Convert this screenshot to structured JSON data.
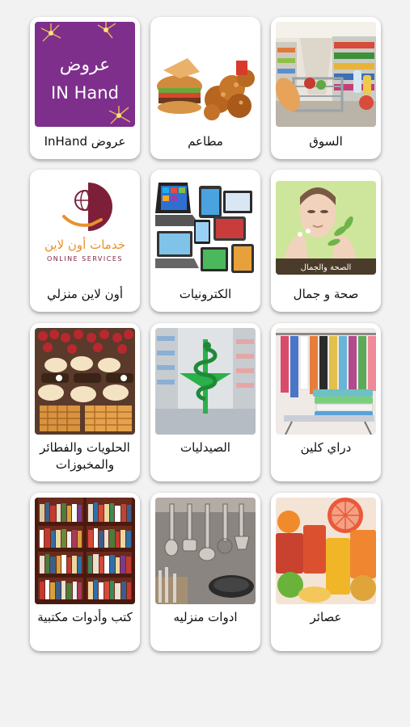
{
  "categories": [
    {
      "label": "السوق",
      "icon": "supermarket-image"
    },
    {
      "label": "مطاعم",
      "icon": "fastfood-image"
    },
    {
      "label": "عروض InHand",
      "icon": "offers-inhand-image",
      "image_text": "عروض IN Hand"
    },
    {
      "label": "صحة و جمال",
      "icon": "health-beauty-image",
      "image_text": "الصحة والجمال"
    },
    {
      "label": "الكترونيات",
      "icon": "electronics-image"
    },
    {
      "label": "أون لاين منزلي",
      "icon": "online-services-logo",
      "image_text_ar": "خدمات أون لاين",
      "image_text_en": "ONLINE SERVICES"
    },
    {
      "label": "دراي كلين",
      "icon": "dry-clean-image"
    },
    {
      "label": "الصيدليات",
      "icon": "pharmacy-image"
    },
    {
      "label": "الحلويات والفطائر والمخبوزات",
      "icon": "sweets-bakery-image"
    },
    {
      "label": "عصائر",
      "icon": "juices-image"
    },
    {
      "label": "ادوات منزليه",
      "icon": "kitchen-tools-image"
    },
    {
      "label": "كتب وأدوات مكتبية",
      "icon": "books-stationery-image"
    }
  ]
}
